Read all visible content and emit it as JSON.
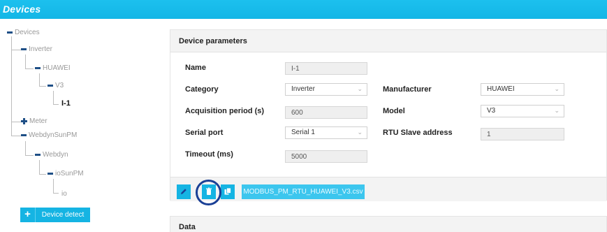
{
  "header": {
    "title": "Devices"
  },
  "tree": {
    "root": "Devices",
    "inverter": "Inverter",
    "huawei": "HUAWEI",
    "v3": "V3",
    "i1": "I-1",
    "meter": "Meter",
    "webdynsunpm": "WebdynSunPM",
    "webdyn": "Webdyn",
    "iosunpm": "ioSunPM",
    "io": "io"
  },
  "device_detect": {
    "plus_label": "+",
    "label": "Device detect"
  },
  "panel": {
    "title": "Device parameters",
    "fields": {
      "name": {
        "label": "Name",
        "value": "I-1"
      },
      "category": {
        "label": "Category",
        "value": "Inverter"
      },
      "acquisition": {
        "label": "Acquisition period (s)",
        "value": "600"
      },
      "serial_port": {
        "label": "Serial port",
        "value": "Serial 1"
      },
      "timeout": {
        "label": "Timeout (ms)",
        "value": "5000"
      },
      "manufacturer": {
        "label": "Manufacturer",
        "value": "HUAWEI"
      },
      "model": {
        "label": "Model",
        "value": "V3"
      },
      "rtu": {
        "label": "RTU Slave address",
        "value": "1"
      }
    },
    "toolbar": {
      "csv_label": "MODBUS_PM_RTU_HUAWEI_V3.csv",
      "icons": [
        "pencil-icon",
        "trash-icon",
        "copy-icon"
      ]
    }
  },
  "data_panel": {
    "title": "Data"
  },
  "colors": {
    "accent": "#15b4e3",
    "highlight_ring": "#1a3f95",
    "tree_sign": "#1e4f86"
  }
}
